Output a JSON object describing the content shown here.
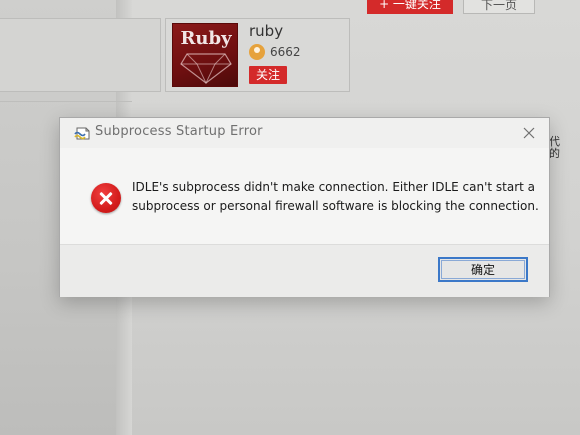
{
  "background": {
    "top_buttons": {
      "follow_all_label": "+ 一键关注",
      "next_page_label": "下一页"
    },
    "user_card": {
      "logo_text": "Ruby",
      "name": "ruby",
      "count": "6662",
      "follow_label": "关注"
    },
    "side_chars": [
      "代",
      "的"
    ]
  },
  "dialog": {
    "title": "Subprocess Startup Error",
    "message_lines": [
      "IDLE's subprocess didn't make connection.  Either IDLE can't start a",
      "subprocess or personal firewall software is blocking the connection."
    ],
    "ok_label": "确定",
    "icons": {
      "title": "python-idle-icon",
      "close": "close-icon",
      "error": "error-icon"
    },
    "colors": {
      "error_red": "#d41c1c",
      "focus_border": "#3b78c8"
    }
  }
}
